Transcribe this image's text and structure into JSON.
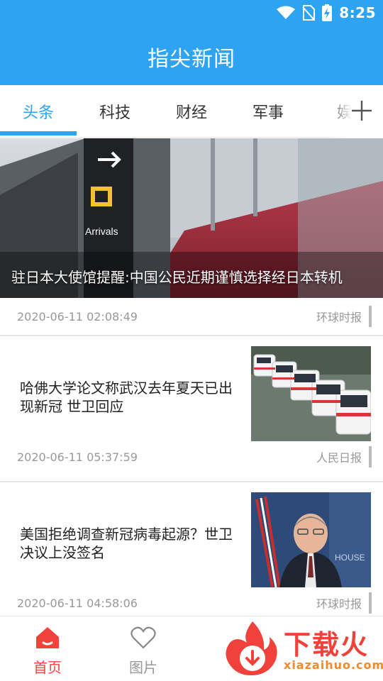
{
  "status": {
    "time": "8:25"
  },
  "header": {
    "title": "指尖新闻"
  },
  "tabs": [
    {
      "label": "头条"
    },
    {
      "label": "科技"
    },
    {
      "label": "财经"
    },
    {
      "label": "军事"
    },
    {
      "label": "娱"
    }
  ],
  "articles": [
    {
      "title": "驻日本大使馆提醒:中国公民近期谨慎选择经日本转机",
      "date": "2020-06-11 02:08:49",
      "source": "环球时报",
      "image_text": "Arrivals"
    },
    {
      "title": "哈佛大学论文称武汉去年夏天已出现新冠 世卫回应",
      "date": "2020-06-11 05:37:59",
      "source": "人民日报"
    },
    {
      "title": "美国拒绝调查新冠病毒起源？世卫决议上没签名",
      "date": "2020-06-11 04:58:06",
      "source": "环球时报",
      "image_text": "HOUSE"
    }
  ],
  "bottom_nav": [
    {
      "label": "首页",
      "icon": "home-icon"
    },
    {
      "label": "图片",
      "icon": "heart-icon"
    }
  ],
  "watermark": {
    "text": "下载火",
    "sub": "xiazaihuo.com"
  },
  "colors": {
    "primary": "#2ea3f2",
    "accent": "#f0423a"
  }
}
